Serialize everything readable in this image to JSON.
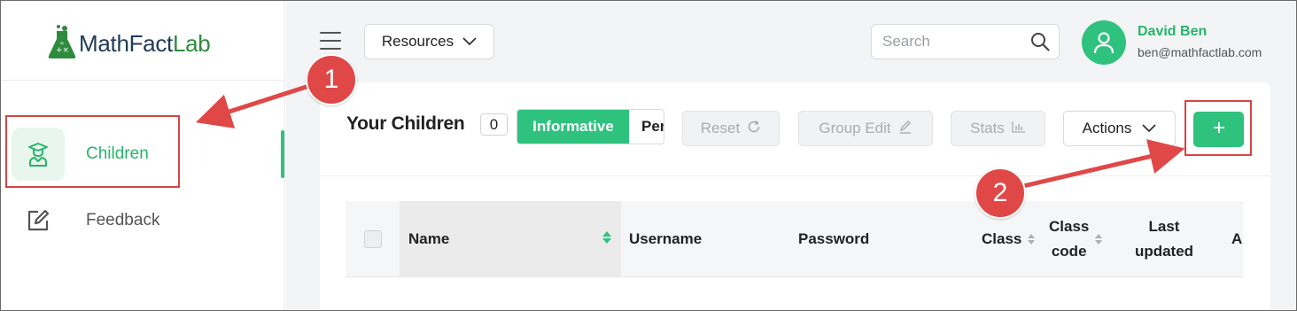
{
  "app": {
    "logo_main": "MathFact",
    "logo_accent": "Lab"
  },
  "sidebar": {
    "items": [
      {
        "label": "Children",
        "icon": "student-icon",
        "active": true
      },
      {
        "label": "Feedback",
        "icon": "edit-icon",
        "active": false
      }
    ]
  },
  "header": {
    "resources_label": "Resources",
    "search_placeholder": "Search",
    "user_name": "David Ben",
    "user_email": "ben@mathfactlab.com"
  },
  "toolbar": {
    "title": "Your Children",
    "count": "0",
    "toggle_on": "Informative",
    "toggle_off": "Per",
    "reset_label": "Reset",
    "group_edit_label": "Group Edit",
    "stats_label": "Stats",
    "actions_label": "Actions",
    "add_label": "+"
  },
  "table": {
    "headers": {
      "name": "Name",
      "username": "Username",
      "password": "Password",
      "class": "Class",
      "class_code_1": "Class",
      "class_code_2": "code",
      "last_updated_1": "Last",
      "last_updated_2": "updated",
      "actions": "Ac"
    }
  },
  "annotations": {
    "step1": "1",
    "step2": "2"
  },
  "colors": {
    "brand_green": "#2ec27e",
    "annotation_red": "#e04848",
    "logo_navy": "#1f3b57"
  }
}
